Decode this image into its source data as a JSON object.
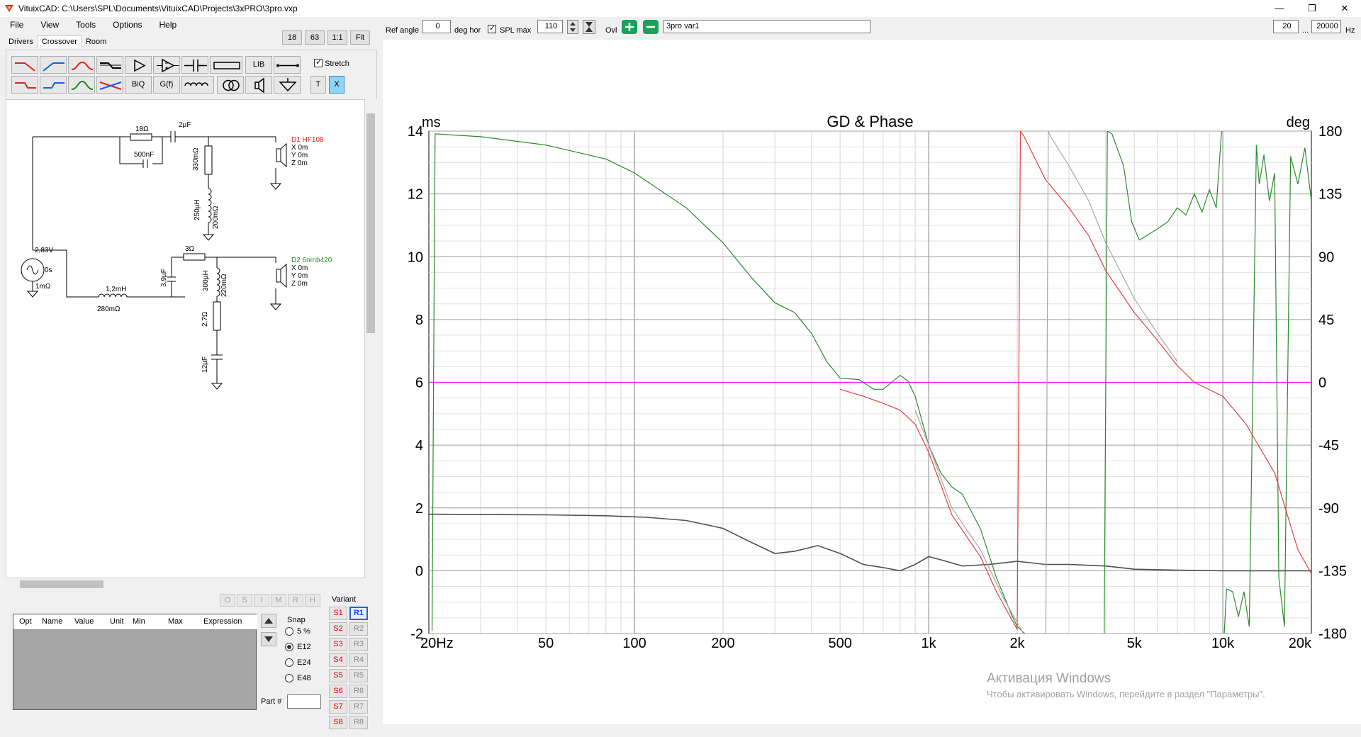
{
  "window": {
    "title": "VituixCAD: C:\\Users\\SPL\\Documents\\VituixCAD\\Projects\\3xPRO\\3pro.vxp",
    "min": "—",
    "max": "❐",
    "close": "✕"
  },
  "menu": [
    "File",
    "View",
    "Tools",
    "Options",
    "Help"
  ],
  "tabs": [
    "Drivers",
    "Crossover",
    "Room"
  ],
  "active_tab": "Crossover",
  "view_buttons": [
    "18",
    "63",
    "1:1",
    "Fit"
  ],
  "toolbox": {
    "row1_text": [
      "LIB"
    ],
    "stretch_label": "Stretch",
    "stretch_checked": true,
    "row2_text": [
      "BiQ",
      "G(f)",
      "T",
      "X"
    ]
  },
  "schematic": {
    "r1": "18Ω",
    "c1": "2µF",
    "c2": "500nF",
    "r2": "330mΩ",
    "l1": "250µH",
    "r3": "200mΩ",
    "d1_name": "D1 HF108",
    "d1_x": "X 0m",
    "d1_y": "Y 0m",
    "d1_z": "Z 0m",
    "src_v": "2,83V",
    "src_t": "0s",
    "src_r": "1mΩ",
    "r4": "3Ω",
    "c3": "3,9µF",
    "l2": "300µH",
    "r5": "220mΩ",
    "l3": "1,2mH",
    "r6": "280mΩ",
    "r7": "2,7Ω",
    "c4": "12µF",
    "d2_name": "D2 6nmb420",
    "d2_x": "X 0m",
    "d2_y": "Y 0m",
    "d2_z": "Z 0m"
  },
  "opt_buttons": [
    "O",
    "S",
    "I",
    "M",
    "R",
    "H"
  ],
  "opt_table_headers": [
    "Opt",
    "Name",
    "Value",
    "Unit",
    "Min",
    "Max",
    "Expression"
  ],
  "snap": {
    "label": "Snap",
    "options": [
      "5 %",
      "E12",
      "E24",
      "E48"
    ],
    "selected": "E12",
    "part_label": "Part #",
    "part_value": ""
  },
  "variant": {
    "label": "Variant",
    "s": [
      "S1",
      "S2",
      "S3",
      "S4",
      "S5",
      "S6",
      "S7",
      "S8"
    ],
    "r": [
      "R1",
      "R2",
      "R3",
      "R4",
      "R5",
      "R6",
      "R7",
      "R8"
    ],
    "active": "R1"
  },
  "chart_controls": {
    "ref_angle_label": "Ref angle",
    "ref_angle_value": "0",
    "deg_hor_label": "deg hor",
    "spl_max_label": "SPL max",
    "spl_max_checked": true,
    "spl_max_value": "110",
    "ovl_label": "Ovl",
    "overlay_name": "3pro var1",
    "freq_min": "20",
    "freq_sep": "...",
    "freq_max": "20000",
    "freq_unit": "Hz"
  },
  "chart_data": {
    "type": "line",
    "title": "GD & Phase",
    "ylabel": "ms",
    "y2label": "deg",
    "xscale": "log",
    "xlim": [
      20,
      20000
    ],
    "ylim": [
      -2,
      14
    ],
    "y2lim": [
      -180,
      180
    ],
    "xticks": [
      20,
      50,
      100,
      200,
      500,
      1000,
      2000,
      5000,
      10000,
      20000
    ],
    "xticklabels": [
      "20Hz",
      "50",
      "100",
      "200",
      "500",
      "1k",
      "2k",
      "5k",
      "10k",
      "20k"
    ],
    "yticks": [
      -2,
      0,
      2,
      4,
      6,
      8,
      10,
      12,
      14
    ],
    "yticklabels": [
      "-2",
      "0",
      "2",
      "4",
      "6",
      "8",
      "10",
      "12",
      "14"
    ],
    "y2ticks": [
      -180,
      -135,
      -90,
      -45,
      0,
      45,
      90,
      135,
      180
    ],
    "y2ticklabels": [
      "-180",
      "-135",
      "-90",
      "-45",
      "0",
      "45",
      "90",
      "135",
      "180"
    ],
    "grid": true,
    "legend": "none",
    "series": [
      {
        "color": "#ff00ff",
        "axis": "y",
        "x": [
          20,
          20000
        ],
        "y": [
          6,
          6
        ]
      },
      {
        "color": "#505050",
        "axis": "y",
        "x": [
          20,
          50,
          80,
          110,
          150,
          200,
          250,
          300,
          350,
          420,
          500,
          600,
          700,
          800,
          900,
          1000,
          1150,
          1300,
          1600,
          2000,
          2500,
          3000,
          4000,
          5000,
          7000,
          10000,
          15000,
          20000
        ],
        "y": [
          1.8,
          1.78,
          1.75,
          1.7,
          1.6,
          1.35,
          0.9,
          0.55,
          0.62,
          0.8,
          0.55,
          0.2,
          0.1,
          0.0,
          0.2,
          0.45,
          0.3,
          0.15,
          0.2,
          0.3,
          0.2,
          0.2,
          0.15,
          0.05,
          0.02,
          0.0,
          0.0,
          0.0
        ]
      },
      {
        "color": "#2a8a2a",
        "axis": "y2",
        "x": [
          20.5,
          21,
          30,
          50,
          80,
          100,
          150,
          200,
          250,
          300,
          350,
          400,
          450,
          500,
          580,
          650,
          700,
          800,
          850,
          900,
          1000,
          1100,
          1200,
          1300,
          1500,
          1700,
          1900,
          2000,
          2200,
          2500,
          2800,
          3000,
          3500,
          3950
        ],
        "y": [
          -178,
          178,
          176,
          170,
          160,
          150,
          125,
          100,
          75,
          57,
          50,
          35,
          15,
          3,
          2,
          -5,
          -5,
          5,
          1,
          -10,
          -45,
          -65,
          -75,
          -80,
          -105,
          -140,
          -165,
          -175,
          -183,
          -180,
          -189,
          -193,
          -197,
          -202
        ]
      },
      {
        "color": "#2a8a2a",
        "axis": "y2",
        "x": [
          3950,
          4050,
          4200,
          4600,
          4900,
          5200,
          5500,
          6000,
          6500,
          7000,
          7500,
          8000,
          8500,
          9000,
          9500,
          9900
        ],
        "y": [
          -180,
          180,
          178,
          155,
          115,
          102,
          105,
          110,
          115,
          125,
          120,
          135,
          122,
          138,
          125,
          180
        ]
      },
      {
        "color": "#2a8a2a",
        "axis": "y2",
        "x": [
          10050,
          10300,
          10800,
          11300,
          11800,
          12300,
          13000,
          13300,
          13800,
          14400,
          15000,
          15500,
          16200,
          17000,
          18000,
          19000,
          20000
        ],
        "y": [
          -190,
          -148,
          -150,
          -168,
          -150,
          -175,
          170,
          142,
          163,
          130,
          150,
          -140,
          -175,
          162,
          142,
          168,
          130
        ]
      },
      {
        "color": "#e04040",
        "axis": "y2",
        "x": [
          500,
          600,
          700,
          800,
          900,
          1000,
          1200,
          1500,
          1700,
          2000,
          2050,
          2100,
          2500,
          3000,
          3500,
          4000,
          5000,
          6000,
          7000,
          8000,
          10000,
          12000,
          15000,
          18000,
          20000
        ],
        "y": [
          -5,
          -10,
          -15,
          -20,
          -30,
          -50,
          -95,
          -125,
          -150,
          -177,
          180,
          177,
          145,
          125,
          105,
          80,
          50,
          30,
          12,
          0,
          -10,
          -30,
          -65,
          -120,
          -137
        ]
      },
      {
        "color": "#a8a8a8",
        "axis": "y2",
        "x": [
          900,
          1000,
          1200,
          1500,
          1800,
          2100,
          2350,
          2500,
          2550,
          2600,
          3000,
          3500,
          4000,
          5000,
          6000,
          7000
        ],
        "y": [
          -20,
          -45,
          -90,
          -120,
          -155,
          -180,
          -193,
          -200,
          180,
          176,
          155,
          130,
          100,
          60,
          35,
          15
        ]
      }
    ]
  },
  "watermark": {
    "title": "Активация Windows",
    "subtitle": "Чтобы активировать Windows, перейдите в раздел \"Параметры\"."
  }
}
